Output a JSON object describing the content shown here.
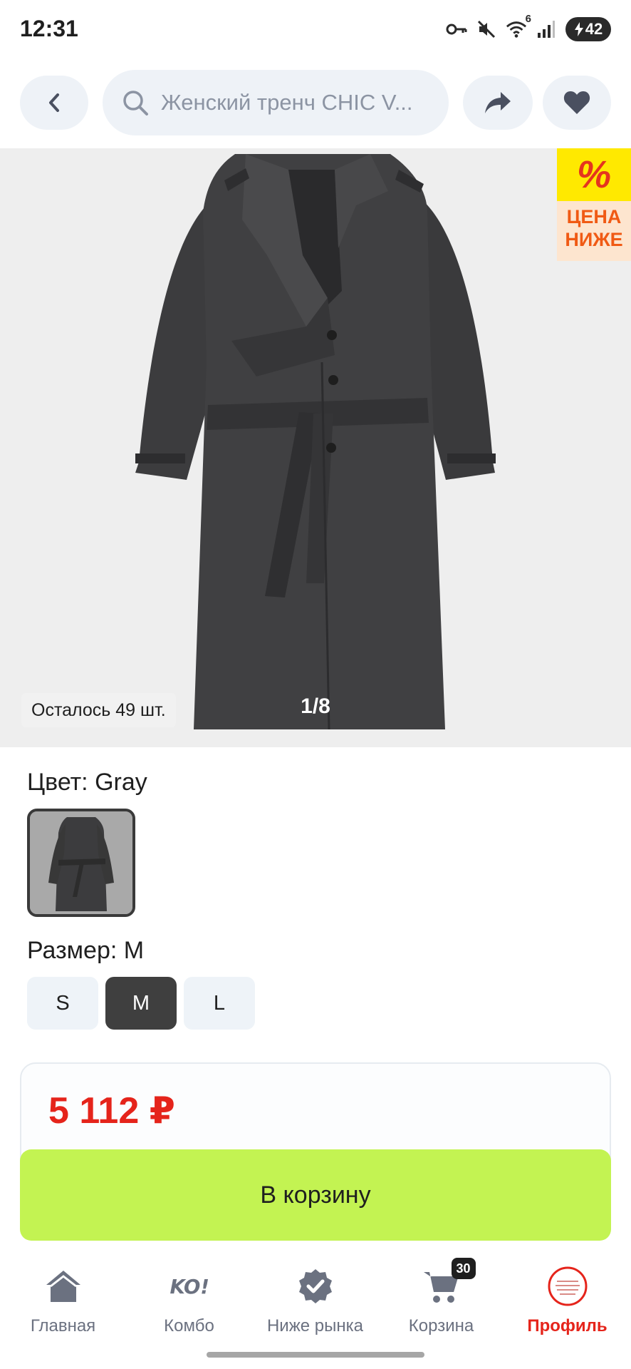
{
  "status_bar": {
    "time": "12:31",
    "battery": "42",
    "network_badge": "6"
  },
  "search": {
    "text": "Женский тренч CHIC V..."
  },
  "gallery": {
    "promo_percent": "%",
    "promo_text_1": "ЦЕНА",
    "promo_text_2": "НИЖЕ",
    "stock": "Осталось 49 шт.",
    "counter": "1/8"
  },
  "product": {
    "color_label": "Цвет: Gray",
    "size_label": "Размер: M",
    "sizes": [
      {
        "label": "S",
        "selected": false
      },
      {
        "label": "M",
        "selected": true
      },
      {
        "label": "L",
        "selected": false
      }
    ],
    "price": "5 112 ₽",
    "add_to_cart": "В корзину"
  },
  "bottom_nav": {
    "items": [
      {
        "label": "Главная",
        "icon": "home-icon"
      },
      {
        "label": "Комбо",
        "icon": "combo-logo-icon"
      },
      {
        "label": "Ниже рынка",
        "icon": "verified-badge-icon"
      },
      {
        "label": "Корзина",
        "icon": "cart-icon",
        "badge": "30"
      },
      {
        "label": "Профиль",
        "icon": "avatar-icon",
        "active": true
      }
    ]
  },
  "colors": {
    "accent_price": "#e5241b",
    "cart_button": "#c3f352",
    "chip_background": "#eef2f7"
  }
}
